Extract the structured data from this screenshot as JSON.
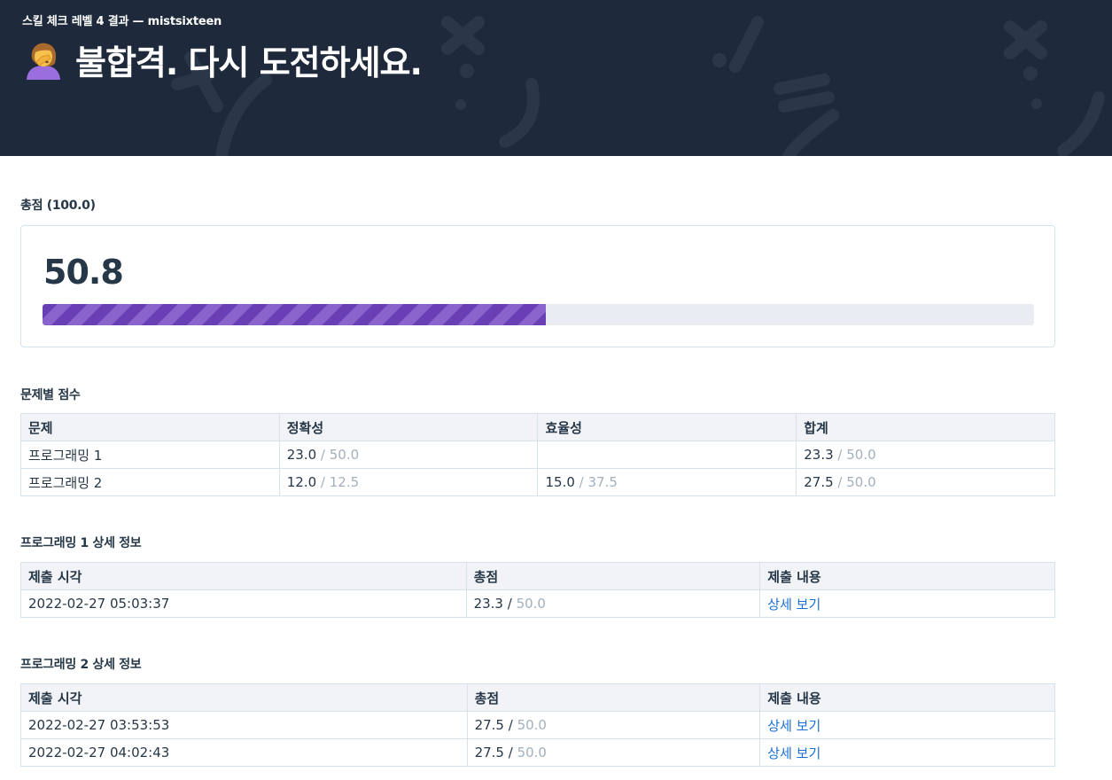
{
  "header": {
    "subtitle": "스킬 체크 레벨 4 결과 — mistsixteen",
    "title": "불합격. 다시 도전하세요.",
    "emoji_icon": "person-facepalming-icon",
    "background": "#1e2a3b"
  },
  "total": {
    "label": "총점 (100.0)",
    "score": "50.8",
    "progress_fraction": 0.508,
    "bar_color": "#6a3fb5"
  },
  "problems": {
    "title": "문제별 점수",
    "columns": [
      "문제",
      "정확성",
      "효율성",
      "합계"
    ],
    "rows": [
      {
        "name": "프로그래밍 1",
        "accuracy": "23.0",
        "accuracy_max": "/ 50.0",
        "efficiency": "",
        "efficiency_max": "",
        "total": "23.3",
        "total_max": "/ 50.0"
      },
      {
        "name": "프로그래밍 2",
        "accuracy": "12.0",
        "accuracy_max": "/ 12.5",
        "efficiency": "15.0",
        "efficiency_max": "/ 37.5",
        "total": "27.5",
        "total_max": "/ 50.0"
      }
    ]
  },
  "detail1": {
    "title": "프로그래밍 1 상세 정보",
    "columns": [
      "제출 시각",
      "총점",
      "제출 내용"
    ],
    "rows": [
      {
        "time": "2022-02-27 05:03:37",
        "score": "23.3",
        "max": "50.0",
        "link": "상세 보기"
      }
    ]
  },
  "detail2": {
    "title": "프로그래밍 2 상세 정보",
    "columns": [
      "제출 시각",
      "총점",
      "제출 내용"
    ],
    "rows": [
      {
        "time": "2022-02-27 03:53:53",
        "score": "27.5",
        "max": "50.0",
        "link": "상세 보기"
      },
      {
        "time": "2022-02-27 04:02:43",
        "score": "27.5",
        "max": "50.0",
        "link": "상세 보기"
      }
    ]
  },
  "colors": {
    "link": "#1a6fd6",
    "muted": "#a2b0bd",
    "border": "#d7e2eb"
  }
}
